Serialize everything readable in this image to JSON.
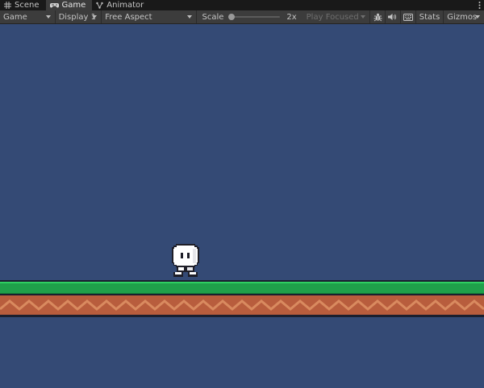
{
  "tabs": [
    {
      "label": "Scene",
      "icon": "grid-icon",
      "active": false
    },
    {
      "label": "Game",
      "icon": "gamepad-icon",
      "active": true
    },
    {
      "label": "Animator",
      "icon": "animator-icon",
      "active": false
    }
  ],
  "toolbar": {
    "view_mode": "Game",
    "display": "Display 1",
    "aspect": "Free Aspect",
    "scale_label": "Scale",
    "scale_value": "2x",
    "play_mode": "Play Focused",
    "stats_label": "Stats",
    "gizmos_label": "Gizmos"
  },
  "colors": {
    "background": "#344a75",
    "grass": "#1fa04a",
    "dirt": "#b85d3d",
    "dirt_pattern": "#d98a5f",
    "player_body": "#ffffff"
  }
}
